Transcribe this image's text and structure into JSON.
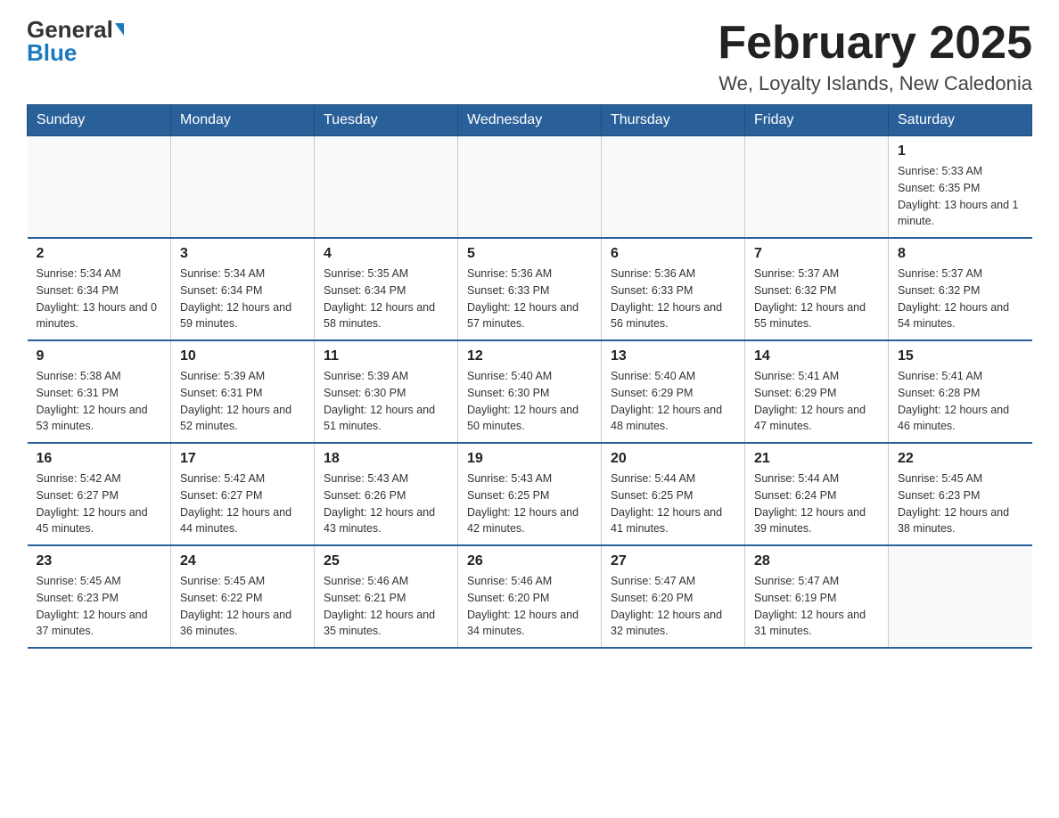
{
  "header": {
    "logo_general": "General",
    "logo_blue": "Blue",
    "month_title": "February 2025",
    "location": "We, Loyalty Islands, New Caledonia"
  },
  "days_of_week": [
    "Sunday",
    "Monday",
    "Tuesday",
    "Wednesday",
    "Thursday",
    "Friday",
    "Saturday"
  ],
  "weeks": [
    [
      {
        "day": "",
        "info": ""
      },
      {
        "day": "",
        "info": ""
      },
      {
        "day": "",
        "info": ""
      },
      {
        "day": "",
        "info": ""
      },
      {
        "day": "",
        "info": ""
      },
      {
        "day": "",
        "info": ""
      },
      {
        "day": "1",
        "info": "Sunrise: 5:33 AM\nSunset: 6:35 PM\nDaylight: 13 hours and 1 minute."
      }
    ],
    [
      {
        "day": "2",
        "info": "Sunrise: 5:34 AM\nSunset: 6:34 PM\nDaylight: 13 hours and 0 minutes."
      },
      {
        "day": "3",
        "info": "Sunrise: 5:34 AM\nSunset: 6:34 PM\nDaylight: 12 hours and 59 minutes."
      },
      {
        "day": "4",
        "info": "Sunrise: 5:35 AM\nSunset: 6:34 PM\nDaylight: 12 hours and 58 minutes."
      },
      {
        "day": "5",
        "info": "Sunrise: 5:36 AM\nSunset: 6:33 PM\nDaylight: 12 hours and 57 minutes."
      },
      {
        "day": "6",
        "info": "Sunrise: 5:36 AM\nSunset: 6:33 PM\nDaylight: 12 hours and 56 minutes."
      },
      {
        "day": "7",
        "info": "Sunrise: 5:37 AM\nSunset: 6:32 PM\nDaylight: 12 hours and 55 minutes."
      },
      {
        "day": "8",
        "info": "Sunrise: 5:37 AM\nSunset: 6:32 PM\nDaylight: 12 hours and 54 minutes."
      }
    ],
    [
      {
        "day": "9",
        "info": "Sunrise: 5:38 AM\nSunset: 6:31 PM\nDaylight: 12 hours and 53 minutes."
      },
      {
        "day": "10",
        "info": "Sunrise: 5:39 AM\nSunset: 6:31 PM\nDaylight: 12 hours and 52 minutes."
      },
      {
        "day": "11",
        "info": "Sunrise: 5:39 AM\nSunset: 6:30 PM\nDaylight: 12 hours and 51 minutes."
      },
      {
        "day": "12",
        "info": "Sunrise: 5:40 AM\nSunset: 6:30 PM\nDaylight: 12 hours and 50 minutes."
      },
      {
        "day": "13",
        "info": "Sunrise: 5:40 AM\nSunset: 6:29 PM\nDaylight: 12 hours and 48 minutes."
      },
      {
        "day": "14",
        "info": "Sunrise: 5:41 AM\nSunset: 6:29 PM\nDaylight: 12 hours and 47 minutes."
      },
      {
        "day": "15",
        "info": "Sunrise: 5:41 AM\nSunset: 6:28 PM\nDaylight: 12 hours and 46 minutes."
      }
    ],
    [
      {
        "day": "16",
        "info": "Sunrise: 5:42 AM\nSunset: 6:27 PM\nDaylight: 12 hours and 45 minutes."
      },
      {
        "day": "17",
        "info": "Sunrise: 5:42 AM\nSunset: 6:27 PM\nDaylight: 12 hours and 44 minutes."
      },
      {
        "day": "18",
        "info": "Sunrise: 5:43 AM\nSunset: 6:26 PM\nDaylight: 12 hours and 43 minutes."
      },
      {
        "day": "19",
        "info": "Sunrise: 5:43 AM\nSunset: 6:25 PM\nDaylight: 12 hours and 42 minutes."
      },
      {
        "day": "20",
        "info": "Sunrise: 5:44 AM\nSunset: 6:25 PM\nDaylight: 12 hours and 41 minutes."
      },
      {
        "day": "21",
        "info": "Sunrise: 5:44 AM\nSunset: 6:24 PM\nDaylight: 12 hours and 39 minutes."
      },
      {
        "day": "22",
        "info": "Sunrise: 5:45 AM\nSunset: 6:23 PM\nDaylight: 12 hours and 38 minutes."
      }
    ],
    [
      {
        "day": "23",
        "info": "Sunrise: 5:45 AM\nSunset: 6:23 PM\nDaylight: 12 hours and 37 minutes."
      },
      {
        "day": "24",
        "info": "Sunrise: 5:45 AM\nSunset: 6:22 PM\nDaylight: 12 hours and 36 minutes."
      },
      {
        "day": "25",
        "info": "Sunrise: 5:46 AM\nSunset: 6:21 PM\nDaylight: 12 hours and 35 minutes."
      },
      {
        "day": "26",
        "info": "Sunrise: 5:46 AM\nSunset: 6:20 PM\nDaylight: 12 hours and 34 minutes."
      },
      {
        "day": "27",
        "info": "Sunrise: 5:47 AM\nSunset: 6:20 PM\nDaylight: 12 hours and 32 minutes."
      },
      {
        "day": "28",
        "info": "Sunrise: 5:47 AM\nSunset: 6:19 PM\nDaylight: 12 hours and 31 minutes."
      },
      {
        "day": "",
        "info": ""
      }
    ]
  ]
}
